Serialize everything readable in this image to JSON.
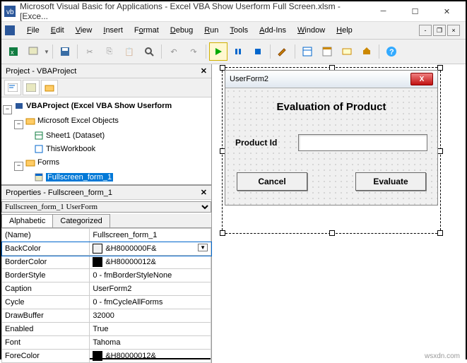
{
  "window": {
    "title": "Microsoft Visual Basic for Applications - Excel VBA Show Userform Full Screen.xlsm - [Exce..."
  },
  "menu": {
    "file": "File",
    "edit": "Edit",
    "view": "View",
    "insert": "Insert",
    "format": "Format",
    "debug": "Debug",
    "run": "Run",
    "tools": "Tools",
    "addins": "Add-Ins",
    "window": "Window",
    "help": "Help"
  },
  "project": {
    "title": "Project - VBAProject",
    "root": "VBAProject (Excel VBA Show Userform",
    "group1": "Microsoft Excel Objects",
    "sheet": "Sheet1 (Dataset)",
    "wb": "ThisWorkbook",
    "group2": "Forms",
    "form": "Fullscreen_form_1"
  },
  "props": {
    "title": "Properties - Fullscreen_form_1",
    "combo": "Fullscreen_form_1 UserForm",
    "tab1": "Alphabetic",
    "tab2": "Categorized",
    "rows": [
      {
        "k": "(Name)",
        "v": "Fullscreen_form_1"
      },
      {
        "k": "BackColor",
        "v": "&H8000000F&",
        "sw": "#f0f0f0",
        "dd": true
      },
      {
        "k": "BorderColor",
        "v": "&H80000012&",
        "sw": "#000"
      },
      {
        "k": "BorderStyle",
        "v": "0 - fmBorderStyleNone"
      },
      {
        "k": "Caption",
        "v": "UserForm2"
      },
      {
        "k": "Cycle",
        "v": "0 - fmCycleAllForms"
      },
      {
        "k": "DrawBuffer",
        "v": "32000"
      },
      {
        "k": "Enabled",
        "v": "True"
      },
      {
        "k": "Font",
        "v": "Tahoma"
      },
      {
        "k": "ForeColor",
        "v": "&H80000012&",
        "sw": "#000"
      }
    ]
  },
  "form": {
    "caption": "UserForm2",
    "heading": "Evaluation of Product",
    "label": "Product Id",
    "cancel": "Cancel",
    "eval": "Evaluate"
  },
  "watermark": "wsxdn.com"
}
